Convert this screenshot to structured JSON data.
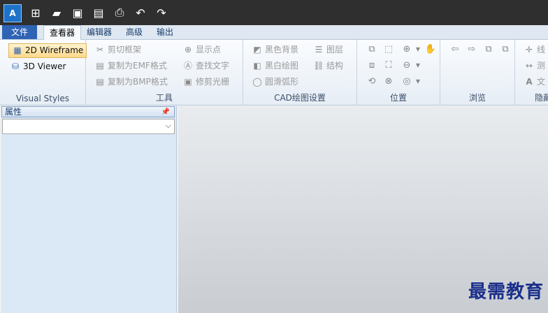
{
  "quick_access": {
    "logo_text": "A",
    "icons": [
      "new-icon",
      "open-folder-icon",
      "save-icon",
      "save-as-pdf-icon",
      "print-icon",
      "undo-icon",
      "redo-icon"
    ]
  },
  "tabs": {
    "file": "文件",
    "viewer": "查看器",
    "editor": "编辑器",
    "advanced": "高级",
    "output": "输出"
  },
  "ribbon": {
    "visual_styles": {
      "label": "Visual Styles",
      "wireframe_2d": "2D Wireframe",
      "viewer_3d": "3D Viewer"
    },
    "tools": {
      "label": "工具",
      "clip_frame": "剪切框架",
      "copy_emf": "复制为EMF格式",
      "copy_bmp": "复制为BMP格式",
      "show_points": "显示点",
      "find_text": "查找文字",
      "trim_raster": "修剪光栅"
    },
    "cad_settings": {
      "label": "CAD绘图设置",
      "black_bg": "黑色背景",
      "bw_drawing": "黑白绘图",
      "smooth_arc": "圆滑弧形",
      "layers": "图层",
      "structure": "结构"
    },
    "position": {
      "label": "位置"
    },
    "browse": {
      "label": "浏览"
    },
    "hidden": {
      "label": "隐藏",
      "line": "线",
      "measure": "测",
      "text": "文"
    }
  },
  "panel": {
    "title": "属性",
    "select_value": ""
  },
  "watermark": "最需教育"
}
